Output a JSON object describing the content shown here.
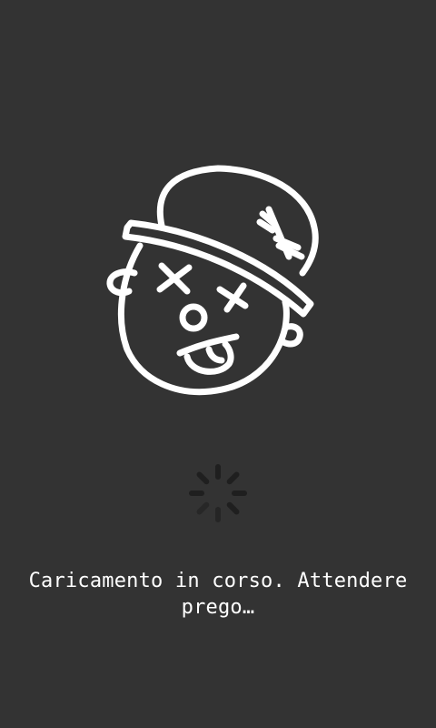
{
  "app": {
    "logo": {
      "icon": "knocked-out-face-with-cap-icon",
      "color": "#ffffff"
    },
    "spinner": {
      "icon": "loading-spinner-icon",
      "color": "#1f1f1f"
    },
    "loading_message": "Caricamento in corso. Attendere prego…"
  },
  "colors": {
    "background": "#333333",
    "text": "#ffffff"
  }
}
